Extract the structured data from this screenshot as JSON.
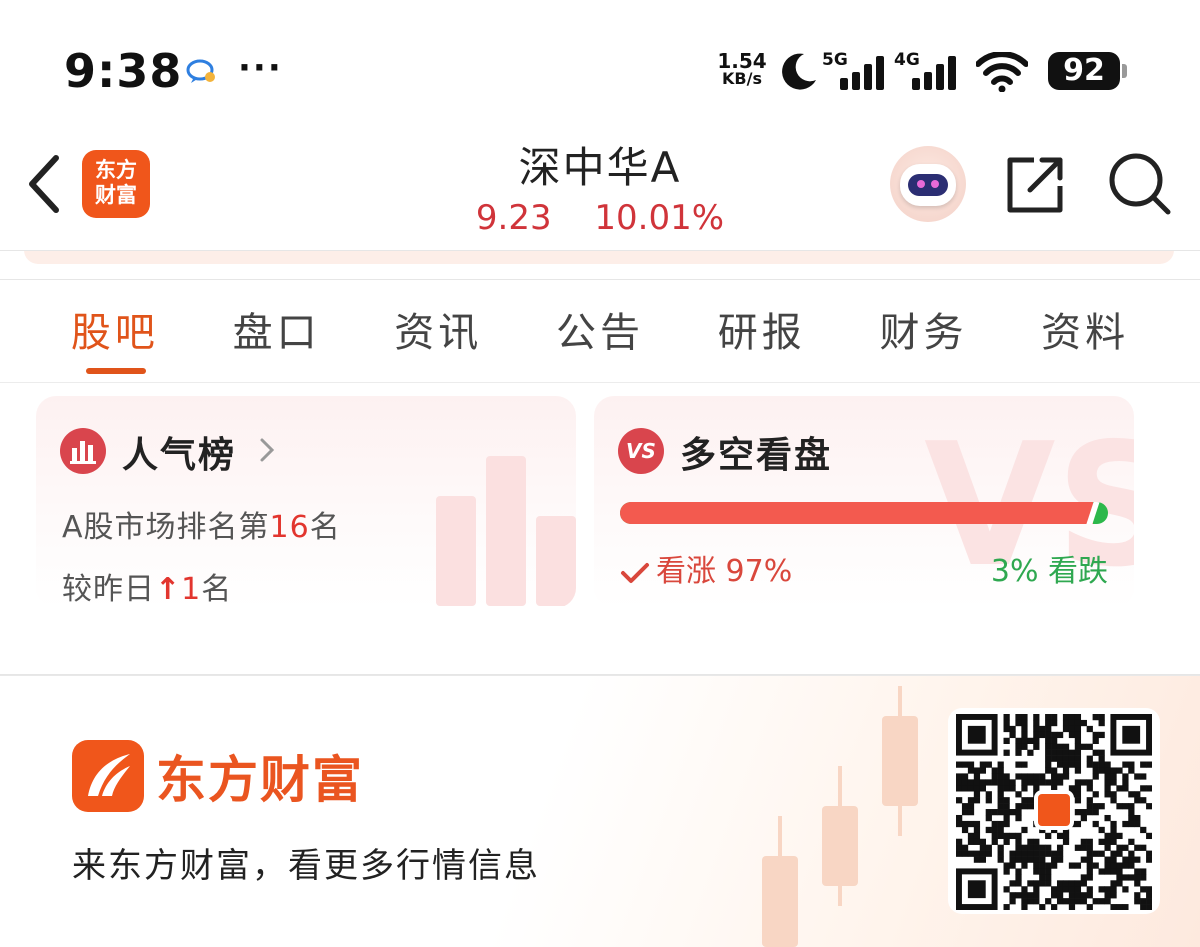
{
  "status_bar": {
    "time": "9:38",
    "more": "···",
    "net_speed_value": "1.54",
    "net_speed_unit": "KB/s",
    "sim1_label": "5G",
    "sim2_label": "4G",
    "battery": "92"
  },
  "header": {
    "logo_line1": "东方",
    "logo_line2": "财富",
    "stock_name": "深中华A",
    "price": "9.23",
    "change_pct": "10.01%"
  },
  "tabs": [
    {
      "label": "股吧",
      "active": true
    },
    {
      "label": "盘口",
      "active": false
    },
    {
      "label": "资讯",
      "active": false
    },
    {
      "label": "公告",
      "active": false
    },
    {
      "label": "研报",
      "active": false
    },
    {
      "label": "财务",
      "active": false
    },
    {
      "label": "资料",
      "active": false
    }
  ],
  "popularity": {
    "title": "人气榜",
    "rank_prefix": "A股市场排名第",
    "rank": "16",
    "rank_suffix": "名",
    "change_prefix": "较昨日",
    "change_arrow": "↑",
    "change_value": "1",
    "change_suffix": "名"
  },
  "sentiment": {
    "icon_text": "VS",
    "title": "多空看盘",
    "bull_label": "看涨 97%",
    "bear_label": "3% 看跌",
    "bull_pct": 97,
    "bear_pct": 3,
    "bull_color": "#f35a4f",
    "bear_color": "#2db84b"
  },
  "promo": {
    "brand_name": "东方财富",
    "slogan": "来东方财富，看更多行情信息"
  },
  "colors": {
    "accent": "#e0541a",
    "brand": "#f0561b",
    "price_up": "#d0343a"
  }
}
